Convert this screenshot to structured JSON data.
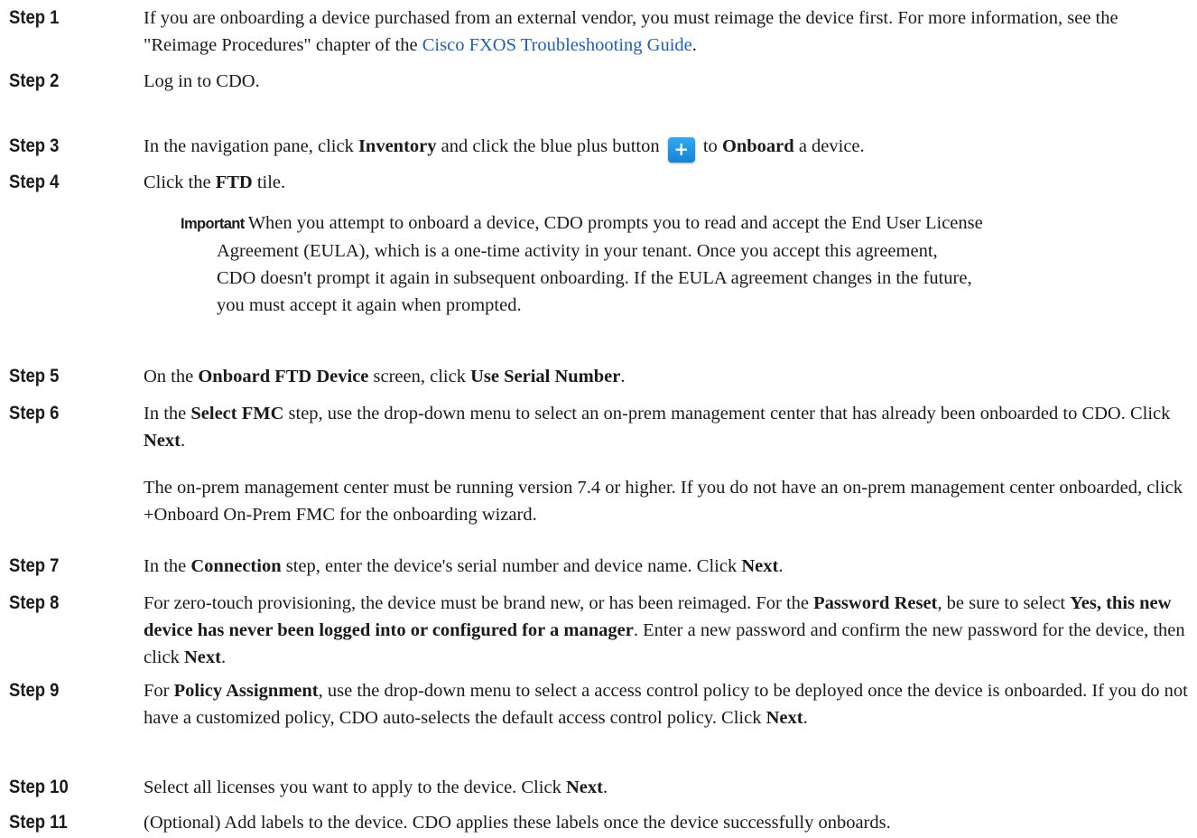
{
  "steps": [
    {
      "label": "Step 1",
      "text_a": "If you are onboarding a device purchased from an external vendor, you must reimage the device first. For more information, see the \"Reimage Procedures\" chapter of the ",
      "link": "Cisco FXOS Troubleshooting Guide",
      "text_b": "."
    },
    {
      "label": "Step 2",
      "text": "Log in to CDO."
    },
    {
      "label": "Step 3",
      "text_a": "In the navigation pane, click ",
      "bold_a": "Inventory",
      "text_b": " and click the blue plus button ",
      "button_glyph": "+",
      "text_c": " to ",
      "bold_b": "Onboard",
      "text_d": " a device."
    },
    {
      "label": "Step 4",
      "text_a": "Click the ",
      "bold_a": "FTD",
      "text_b": " tile."
    },
    {
      "label": "Step 5",
      "text_a": "On the ",
      "bold_a": "Onboard FTD Device",
      "text_b": " screen, click ",
      "bold_b": "Use Serial Number",
      "text_c": "."
    },
    {
      "label": "Step 6",
      "text_a": "In the ",
      "bold_a": "Select FMC",
      "text_b": " step, use the drop-down menu to select an on-prem management center that has already been onboarded to CDO. Click ",
      "bold_b": "Next",
      "text_c": "."
    },
    {
      "label": "Step 7",
      "text_a": "In the ",
      "bold_a": "Connection",
      "text_b": " step, enter the device's serial number and device name. Click ",
      "bold_b": "Next",
      "text_c": "."
    },
    {
      "label": "Step 8",
      "text_a": "For zero-touch provisioning, the device must be brand new, or has been reimaged. For the ",
      "bold_a": "Password Reset",
      "text_b": ", be sure to select ",
      "bold_b": "Yes, this new device has never been logged into or configured for a manager",
      "text_c": ". Enter a new password and confirm the new password for the device, then click ",
      "bold_c": "Next",
      "text_d": "."
    },
    {
      "label": "Step 9",
      "text_a": "For ",
      "bold_a": "Policy Assignment",
      "text_b": ", use the drop-down menu to select a access control policy to be deployed once the device is onboarded. If you do not have a customized policy, CDO auto-selects the default access control policy. Click ",
      "bold_b": "Next",
      "text_c": "."
    },
    {
      "label": "Step 10",
      "text_a": "Select all licenses you want to apply to the device. Click ",
      "bold_a": "Next",
      "text_b": "."
    },
    {
      "label": "Step 11",
      "text": "(Optional) Add labels to the device. CDO applies these labels once the device successfully onboards."
    }
  ],
  "important": {
    "tag": "Important",
    "lines": [
      "When you attempt to onboard a device, CDO prompts you to read and accept the End User License",
      "Agreement (EULA), which is a one-time activity in your tenant. Once you accept this agreement,",
      "CDO doesn't prompt it again in subsequent onboarding. If the EULA agreement changes in the future,",
      "you must accept it again when prompted."
    ]
  },
  "step6_note": "The on-prem management center must be running version 7.4 or higher. If you do not have an on-prem management center onboarded, click +Onboard On-Prem FMC for the onboarding wizard."
}
